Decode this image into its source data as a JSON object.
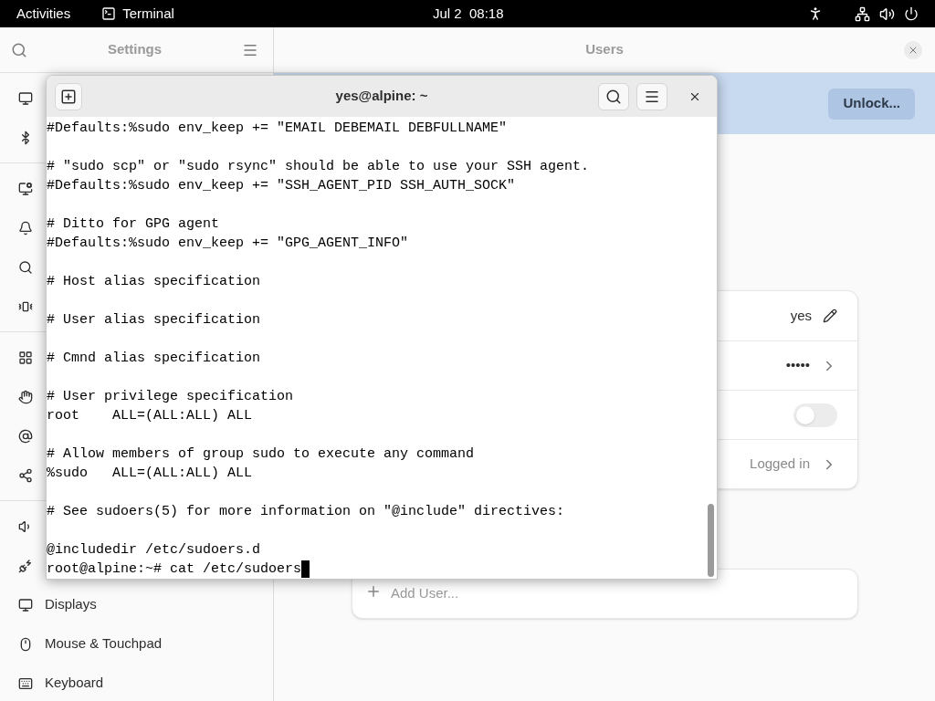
{
  "top_bar": {
    "activities": "Activities",
    "app": "Terminal",
    "clock": "Jul 2  08:18"
  },
  "settings": {
    "title": "Settings",
    "sidebar": {
      "groups": [
        {
          "items": [
            {
              "kind": "covered"
            },
            {
              "kind": "covered"
            }
          ]
        },
        {
          "items": [
            {
              "kind": "covered"
            },
            {
              "kind": "covered"
            },
            {
              "kind": "covered"
            },
            {
              "kind": "covered"
            }
          ]
        },
        {
          "items": [
            {
              "kind": "covered"
            },
            {
              "kind": "covered"
            },
            {
              "kind": "covered"
            },
            {
              "kind": "covered"
            }
          ]
        },
        {
          "items": [
            {
              "kind": "covered"
            },
            {
              "kind": "covered"
            },
            {
              "kind": "labeled",
              "label": "Displays"
            },
            {
              "kind": "labeled",
              "label": "Mouse & Touchpad"
            },
            {
              "kind": "labeled",
              "label": "Keyboard"
            }
          ]
        }
      ]
    }
  },
  "users": {
    "title": "Users",
    "unlock_button": "Unlock...",
    "rows": [
      {
        "kind": "edit",
        "value": "yes"
      },
      {
        "kind": "link",
        "value": "•••••"
      },
      {
        "kind": "toggle",
        "on": false
      },
      {
        "kind": "status",
        "value": "Logged in"
      }
    ],
    "add_user": "Add User..."
  },
  "terminal": {
    "title": "yes@alpine: ~",
    "blocks": [
      [
        "#Defaults:%sudo env_keep += \"EMAIL DEBEMAIL DEBFULLNAME\""
      ],
      [
        "# \"sudo scp\" or \"sudo rsync\" should be able to use your SSH agent.",
        "#Defaults:%sudo env_keep += \"SSH_AGENT_PID SSH_AUTH_SOCK\""
      ],
      [
        "# Ditto for GPG agent",
        "#Defaults:%sudo env_keep += \"GPG_AGENT_INFO\""
      ],
      [
        "# Host alias specification"
      ],
      [
        "# User alias specification"
      ],
      [
        "# Cmnd alias specification"
      ],
      [
        "# User privilege specification",
        "root    ALL=(ALL:ALL) ALL"
      ],
      [
        "# Allow members of group sudo to execute any command",
        "%sudo   ALL=(ALL:ALL) ALL"
      ],
      [
        "# See sudoers(5) for more information on \"@include\" directives:"
      ],
      [
        "@includedir /etc/sudoers.d"
      ]
    ],
    "prompt": "root@alpine:~# cat /etc/sudoers"
  }
}
